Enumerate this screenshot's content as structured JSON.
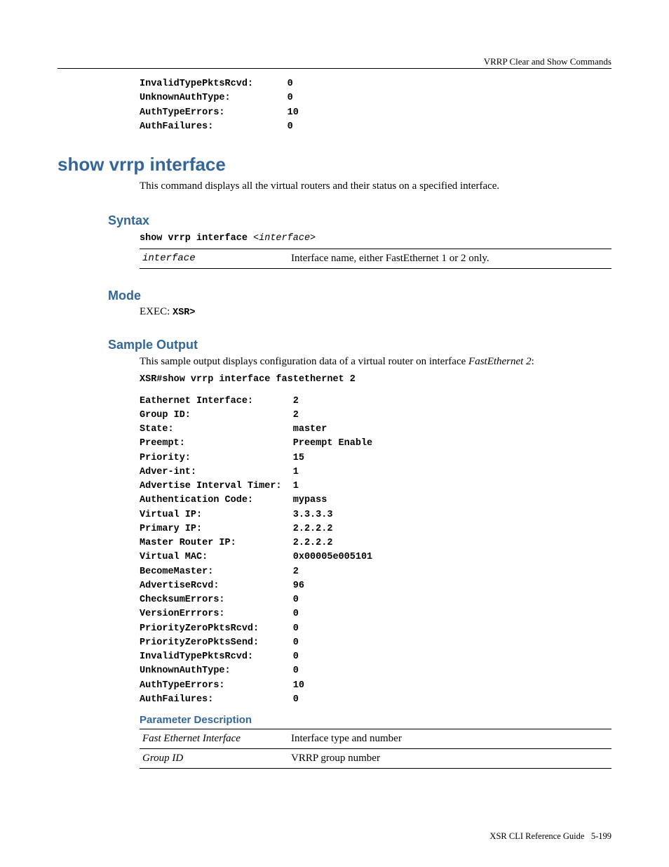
{
  "header": {
    "section": "VRRP Clear and Show Commands"
  },
  "top_output": [
    {
      "k": "InvalidTypePktsRcvd:",
      "v": "0"
    },
    {
      "k": "UnknownAuthType:",
      "v": "0"
    },
    {
      "k": "AuthTypeErrors:",
      "v": "10"
    },
    {
      "k": "AuthFailures:",
      "v": "0"
    }
  ],
  "command": {
    "title": "show vrrp interface",
    "desc": "This command displays all the virtual routers and their status on a specified interface."
  },
  "syntax": {
    "heading": "Syntax",
    "line_cmd": "show vrrp interface ",
    "line_arg": "<interface>",
    "rows": [
      {
        "param": "interface",
        "desc": "Interface name, either FastEthernet 1 or 2 only."
      }
    ]
  },
  "mode": {
    "heading": "Mode",
    "prefix": "EXEC: ",
    "value": "XSR>"
  },
  "sample": {
    "heading": "Sample Output",
    "intro_pre": "This sample output displays configuration data of a virtual router on interface ",
    "intro_em": "FastEthernet 2",
    "intro_post": ":",
    "cmdline": "XSR#show vrrp interface fastethernet 2",
    "rows": [
      {
        "k": "Eathernet Interface:",
        "v": "2"
      },
      {
        "k": "Group ID:",
        "v": "2"
      },
      {
        "k": "State:",
        "v": "master"
      },
      {
        "k": "Preempt:",
        "v": "Preempt Enable"
      },
      {
        "k": "Priority:",
        "v": "15"
      },
      {
        "k": "Adver-int:",
        "v": "1"
      },
      {
        "k": "Advertise Interval Timer:",
        "v": "1"
      },
      {
        "k": "Authentication Code:",
        "v": "mypass"
      },
      {
        "k": "Virtual IP:",
        "v": "3.3.3.3"
      },
      {
        "k": "Primary IP:",
        "v": "2.2.2.2"
      },
      {
        "k": "Master Router IP:",
        "v": "2.2.2.2"
      },
      {
        "k": "Virtual MAC:",
        "v": "0x00005e005101"
      },
      {
        "k": "BecomeMaster:",
        "v": "2"
      },
      {
        "k": "AdvertiseRcvd:",
        "v": "96"
      },
      {
        "k": "ChecksumErrors:",
        "v": "0"
      },
      {
        "k": "VersionErrrors:",
        "v": "0"
      },
      {
        "k": "PriorityZeroPktsRcvd:",
        "v": "0"
      },
      {
        "k": "PriorityZeroPktsSend:",
        "v": "0"
      },
      {
        "k": "InvalidTypePktsRcvd:",
        "v": "0"
      },
      {
        "k": "UnknownAuthType:",
        "v": "0"
      },
      {
        "k": "AuthTypeErrors:",
        "v": "10"
      },
      {
        "k": "AuthFailures:",
        "v": "0"
      }
    ]
  },
  "param_desc": {
    "heading": "Parameter Description",
    "rows": [
      {
        "param": "Fast Ethernet Interface",
        "desc": "Interface type and number"
      },
      {
        "param": "Group ID",
        "desc": "VRRP group number"
      }
    ]
  },
  "footer": {
    "book": "XSR CLI Reference Guide",
    "page": "5-199"
  }
}
